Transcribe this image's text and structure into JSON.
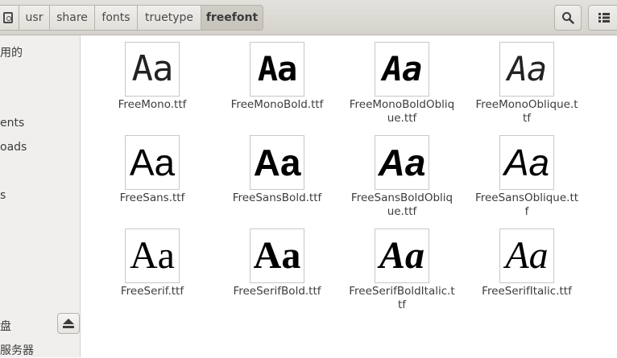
{
  "pathbar": {
    "crumbs": [
      {
        "label": "usr"
      },
      {
        "label": "share"
      },
      {
        "label": "fonts"
      },
      {
        "label": "truetype"
      },
      {
        "label": "freefont"
      }
    ]
  },
  "header": {
    "search_icon": "search-icon",
    "view_icon": "list-view-icon"
  },
  "sidebar": {
    "items": [
      {
        "label": "用的"
      },
      {
        "label": "ents"
      },
      {
        "label": "oads"
      },
      {
        "label": "s"
      },
      {
        "label": "盘"
      },
      {
        "label": "服务器"
      }
    ]
  },
  "files": [
    {
      "thumb": "Aa",
      "name": "FreeMono.ttf"
    },
    {
      "thumb": "Aa",
      "name": "FreeMonoBold.ttf"
    },
    {
      "thumb": "Aa",
      "name": "FreeMonoBoldOblique.ttf"
    },
    {
      "thumb": "Aa",
      "name": "FreeMonoOblique.ttf"
    },
    {
      "thumb": "Aa",
      "name": "FreeSans.ttf"
    },
    {
      "thumb": "Aa",
      "name": "FreeSansBold.ttf"
    },
    {
      "thumb": "Aa",
      "name": "FreeSansBoldOblique.ttf"
    },
    {
      "thumb": "Aa",
      "name": "FreeSansOblique.ttf"
    },
    {
      "thumb": "Aa",
      "name": "FreeSerif.ttf"
    },
    {
      "thumb": "Aa",
      "name": "FreeSerifBold.ttf"
    },
    {
      "thumb": "Aa",
      "name": "FreeSerifBoldItalic.ttf"
    },
    {
      "thumb": "Aa",
      "name": "FreeSerifItalic.ttf"
    }
  ]
}
